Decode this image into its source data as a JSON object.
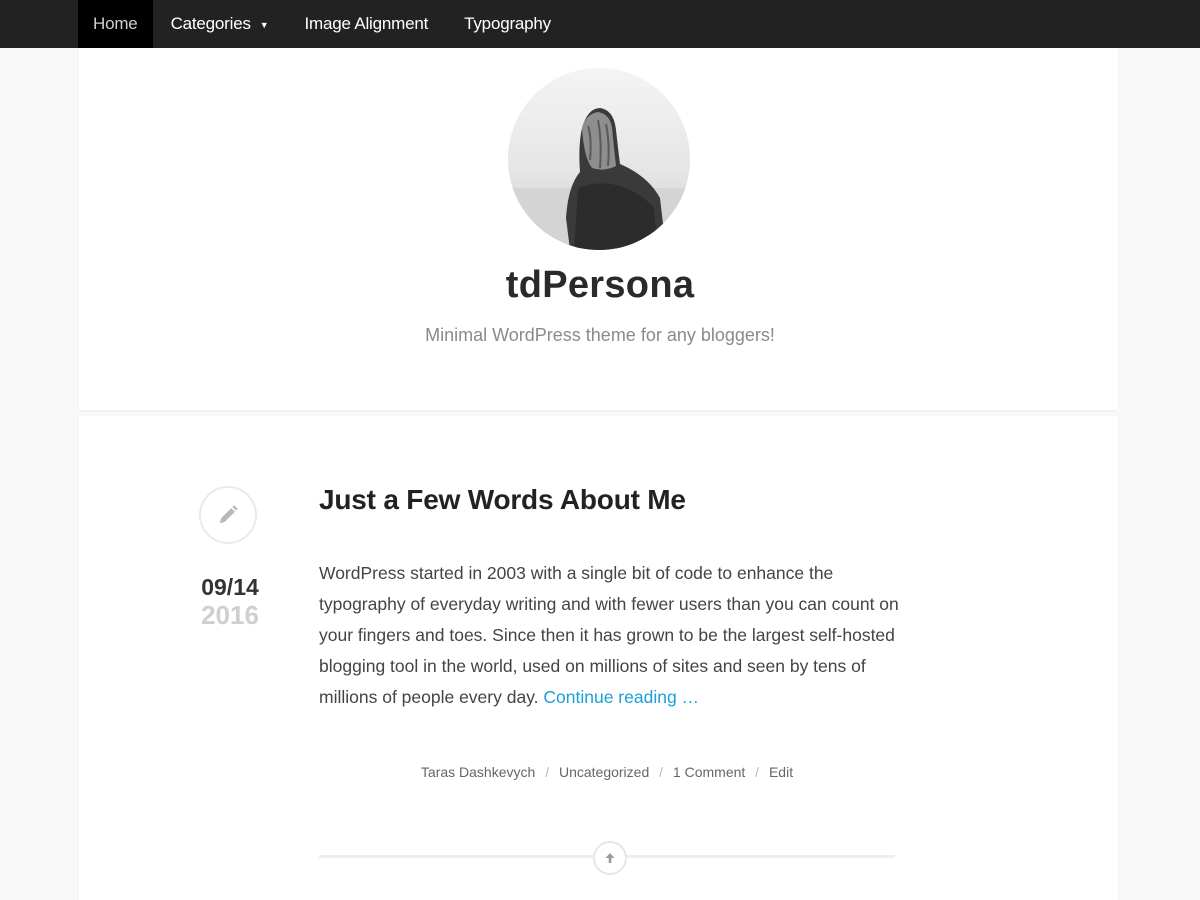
{
  "nav": {
    "items": [
      {
        "label": "Home",
        "active": true
      },
      {
        "label": "Categories",
        "has_dropdown": true
      },
      {
        "label": "Image Alignment"
      },
      {
        "label": "Typography"
      }
    ],
    "dropdown_icon": "caret-down-icon"
  },
  "site": {
    "title": "tdPersona",
    "description": "Minimal WordPress theme for any bloggers!"
  },
  "post": {
    "format_icon": "pencil-icon",
    "date_month_day": "09/14",
    "date_year": "2016",
    "title": "Just a Few Words About Me",
    "excerpt": "WordPress started in 2003 with a single bit of code to enhance the typography of everyday writing and with fewer users than you can count on your fingers and toes. Since then it has grown to be the largest self-hosted blogging tool in the world, used on millions of sites and seen by tens of millions of people every day.",
    "continue_label": "Continue reading …",
    "meta": {
      "author": "Taras Dashkevych",
      "category": "Uncategorized",
      "comments": "1 Comment",
      "edit": "Edit",
      "separator": "/"
    }
  },
  "back_to_top_icon": "arrow-up-icon",
  "colors": {
    "nav_bg": "#222222",
    "nav_active_bg": "#000000",
    "accent_link": "#1a9fd8",
    "year_gray": "#cfcfcf"
  }
}
